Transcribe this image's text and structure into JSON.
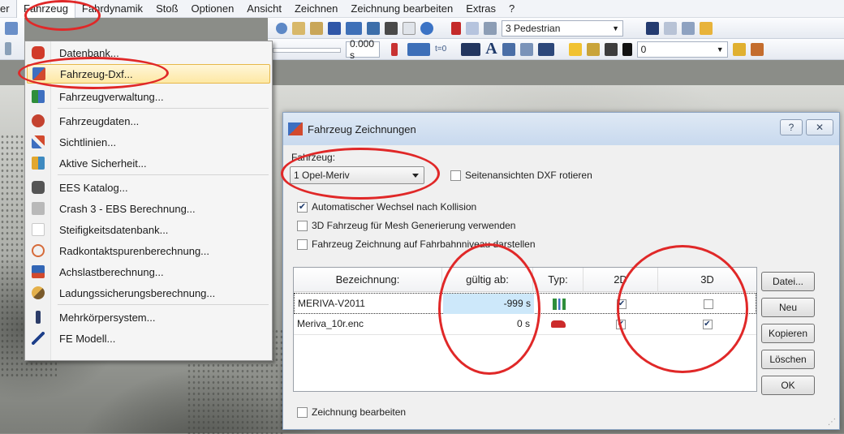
{
  "menubar": {
    "items": [
      "er",
      "Fahrzeug",
      "Fahrdynamik",
      "Stoß",
      "Optionen",
      "Ansicht",
      "Zeichnen",
      "Zeichnung bearbeiten",
      "Extras",
      "?"
    ]
  },
  "toolbar": {
    "pedestrian_combo": "3 Pedestrian",
    "time_value": "0.000 s",
    "t0_label": "t=0",
    "zero_value": "0"
  },
  "fahrzeug_menu": {
    "items": [
      {
        "label": "Datenbank...",
        "icon": "database-car-icon"
      },
      {
        "label": "Fahrzeug-Dxf...",
        "icon": "vehicle-dxf-icon"
      },
      {
        "label": "Fahrzeugverwaltung...",
        "icon": "vehicle-management-icon"
      },
      {
        "label": "Fahrzeugdaten...",
        "icon": "vehicle-data-icon"
      },
      {
        "label": "Sichtlinien...",
        "icon": "sightlines-icon"
      },
      {
        "label": "Aktive Sicherheit...",
        "icon": "active-safety-icon"
      },
      {
        "label": "EES Katalog...",
        "icon": "ees-catalog-icon"
      },
      {
        "label": "Crash 3 - EBS Berechnung...",
        "icon": "crash3-icon"
      },
      {
        "label": "Steifigkeitsdatenbank...",
        "icon": "stiffness-icon"
      },
      {
        "label": "Radkontaktspurenberechnung...",
        "icon": "wheel-contact-icon"
      },
      {
        "label": "Achslastberechnung...",
        "icon": "axle-load-icon"
      },
      {
        "label": "Ladungssicherungsberechnung...",
        "icon": "cargo-securing-icon"
      },
      {
        "label": "Mehrkörpersystem...",
        "icon": "multibody-icon"
      },
      {
        "label": "FE Modell...",
        "icon": "fe-model-icon"
      }
    ]
  },
  "dialog": {
    "title": "Fahrzeug Zeichnungen",
    "help_button": "?",
    "fahrzeug_label": "Fahrzeug:",
    "fahrzeug_selected": "1 Opel-Meriv",
    "rotate_label": "Seitenansichten DXF rotieren",
    "rotate_checked": false,
    "auto_switch_label": "Automatischer Wechsel nach Kollision",
    "auto_switch_checked": true,
    "mesh_label": "3D Fahrzeug für Mesh Generierung verwenden",
    "mesh_checked": false,
    "road_level_label": "Fahrzeug Zeichnung auf Fahrbahnniveau darstellen",
    "road_level_checked": false,
    "columns": [
      "Bezeichnung:",
      "gültig ab:",
      "Typ:",
      "2D",
      "3D"
    ],
    "rows": [
      {
        "name": "MERIVA-V2011",
        "valid_from": "-999 s",
        "type_icon": "vehicle-drawing-icon",
        "d2": true,
        "d3": false
      },
      {
        "name": "Meriva_10r.enc",
        "valid_from": "0 s",
        "type_icon": "red-car-icon",
        "d2": true,
        "d3": true
      }
    ],
    "buttons": [
      "Datei...",
      "Neu",
      "Kopieren",
      "Löschen",
      "OK"
    ],
    "edit_label": "Zeichnung bearbeiten",
    "edit_checked": false
  }
}
